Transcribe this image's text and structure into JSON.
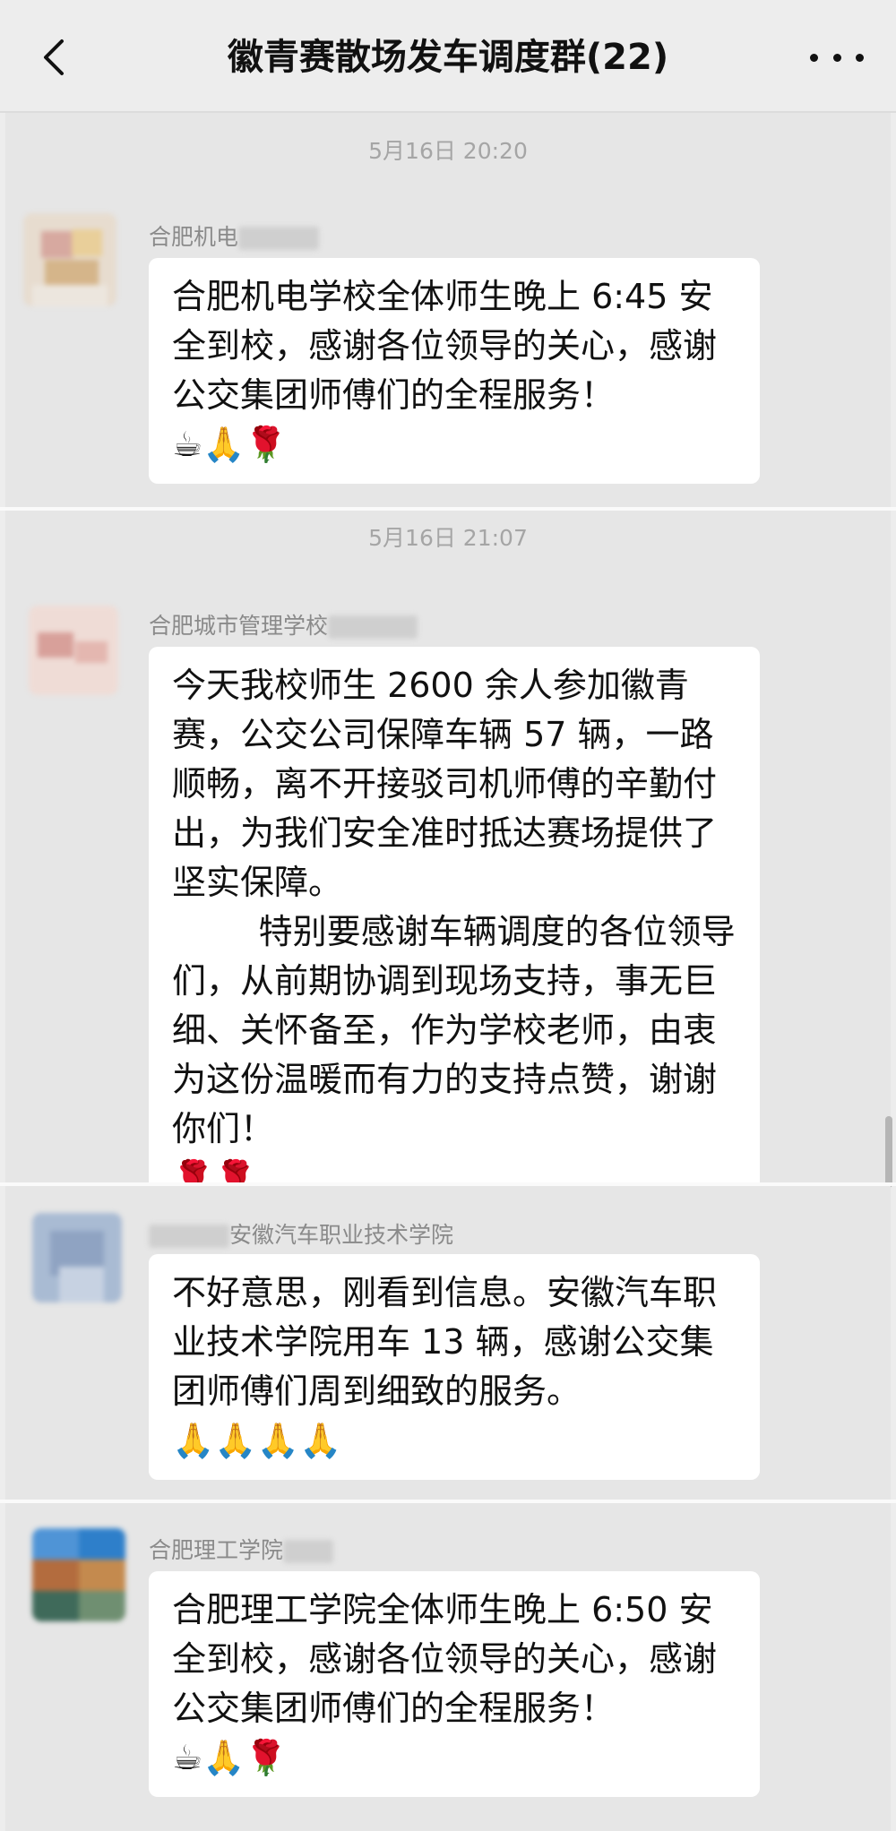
{
  "header": {
    "back_icon": "chevron-left-icon",
    "title": "徽青赛散场发车调度群(22)",
    "more_icon": "more-dots-icon"
  },
  "messages": [
    {
      "time": "5月16日 20:20",
      "sender": "合肥机电",
      "text": "合肥机电学校全体师生晚上 6:45 安全到校，感谢各位领导的关心，感谢公交集团师傅们的全程服务！",
      "emoji": "☕🙏🌹"
    },
    {
      "time": "5月16日 21:07",
      "sender": "合肥城市管理学校",
      "text": "今天我校师生 2600 余人参加徽青赛，公交公司保障车辆 57 辆，一路顺畅，离不开接驳司机师傅的辛勤付出，为我们安全准时抵达赛场提供了坚实保障。",
      "text2": "        特别要感谢车辆调度的各位领导们，从前期协调到现场支持，事无巨细、关怀备至，作为学校老师，由衷为这份温暖而有力的支持点赞，谢谢你们！",
      "emoji": "🌹🌹"
    },
    {
      "sender": "安徽汽车职业技术学院",
      "text": "不好意思，刚看到信息。安徽汽车职业技术学院用车 13 辆，感谢公交集团师傅们周到细致的服务。",
      "emoji": "🙏🙏🙏🙏"
    },
    {
      "sender": "合肥理工学院",
      "text": "合肥理工学院全体师生晚上 6:50 安全到校，感谢各位领导的关心，感谢公交集团师傅们的全程服务！",
      "emoji": "☕🙏🌹"
    }
  ]
}
